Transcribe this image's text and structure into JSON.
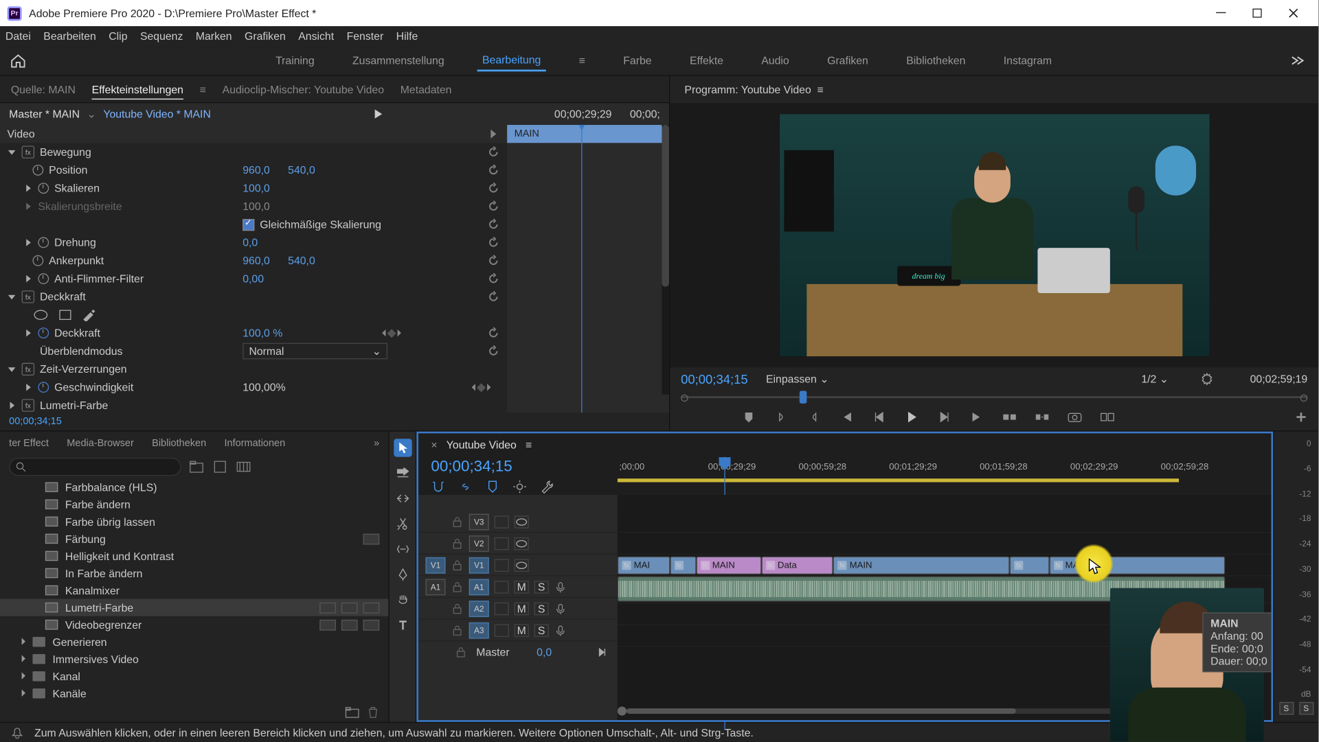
{
  "window": {
    "title": "Adobe Premiere Pro 2020 - D:\\Premiere Pro\\Master Effect *",
    "app_badge": "Pr"
  },
  "menu": [
    "Datei",
    "Bearbeiten",
    "Clip",
    "Sequenz",
    "Marken",
    "Grafiken",
    "Ansicht",
    "Fenster",
    "Hilfe"
  ],
  "workspaces": {
    "items": [
      "Training",
      "Zusammenstellung",
      "Bearbeitung",
      "Farbe",
      "Effekte",
      "Audio",
      "Grafiken",
      "Bibliotheken",
      "Instagram"
    ],
    "active": "Bearbeitung"
  },
  "source_tabs": {
    "items": [
      "Quelle: MAIN",
      "Effekteinstellungen",
      "Audioclip-Mischer: Youtube Video",
      "Metadaten"
    ],
    "active": "Effekteinstellungen"
  },
  "effects": {
    "master_label": "Master * MAIN",
    "clip_label": "Youtube Video * MAIN",
    "tc_head": "00;00;29;29",
    "tc_end": "00;00;",
    "clip_head": "MAIN",
    "video_section": "Video",
    "bewegung": {
      "name": "Bewegung",
      "position": {
        "label": "Position",
        "x": "960,0",
        "y": "540,0"
      },
      "skalieren": {
        "label": "Skalieren",
        "val": "100,0"
      },
      "skalierungsbreite": {
        "label": "Skalierungsbreite",
        "val": "100,0"
      },
      "gleichmaessig": "Gleichmäßige Skalierung",
      "drehung": {
        "label": "Drehung",
        "val": "0,0"
      },
      "ankerpunkt": {
        "label": "Ankerpunkt",
        "x": "960,0",
        "y": "540,0"
      },
      "antiflimmer": {
        "label": "Anti-Flimmer-Filter",
        "val": "0,00"
      }
    },
    "deckkraft": {
      "name": "Deckkraft",
      "value_label": "Deckkraft",
      "value": "100,0 %",
      "blend_label": "Überblendmodus",
      "blend_value": "Normal"
    },
    "zeit": {
      "name": "Zeit-Verzerrungen",
      "speed_label": "Geschwindigkeit",
      "speed_value": "100,00%"
    },
    "lumetri": {
      "name": "Lumetri-Farbe"
    },
    "panel_tc": "00;00;34;15"
  },
  "program": {
    "title": "Programm: Youtube Video",
    "tc_current": "00;00;34;15",
    "fit": "Einpassen",
    "ratio": "1/2",
    "duration": "00;02;59;19",
    "neon_sign": "dream big"
  },
  "project": {
    "tabs": [
      "ter Effect",
      "Media-Browser",
      "Bibliotheken",
      "Informationen"
    ],
    "items": [
      {
        "name": "Farbbalance (HLS)",
        "shortcuts": 0
      },
      {
        "name": "Farbe ändern",
        "shortcuts": 0
      },
      {
        "name": "Farbe übrig lassen",
        "shortcuts": 0
      },
      {
        "name": "Färbung",
        "shortcuts": 1
      },
      {
        "name": "Helligkeit und Kontrast",
        "shortcuts": 0
      },
      {
        "name": "In Farbe ändern",
        "shortcuts": 0
      },
      {
        "name": "Kanalmixer",
        "shortcuts": 0
      },
      {
        "name": "Lumetri-Farbe",
        "shortcuts": 3,
        "selected": true
      },
      {
        "name": "Videobegrenzer",
        "shortcuts": 3
      }
    ],
    "folders": [
      "Generieren",
      "Immersives Video",
      "Kanal",
      "Kanäle"
    ]
  },
  "timeline": {
    "name": "Youtube Video",
    "tc": "00;00;34;15",
    "ruler": [
      ";00;00",
      "00;00;29;29",
      "00;00;59;28",
      "00;01;29;29",
      "00;01;59;28",
      "00;02;29;29",
      "00;02;59;28"
    ],
    "playhead_pct": 19,
    "tracks_v": [
      "V3",
      "V2",
      "V1"
    ],
    "tracks_a": [
      "A1",
      "A2",
      "A3"
    ],
    "src_v": "V1",
    "src_a": "A1",
    "master_label": "Master",
    "master_val": "0,0",
    "clips": [
      {
        "label": "MAI",
        "start": 0,
        "width": 8,
        "color": "blue"
      },
      {
        "label": "",
        "start": 8,
        "width": 4,
        "color": "blue"
      },
      {
        "label": "MAIN",
        "start": 12,
        "width": 10,
        "color": "purple",
        "fx": true
      },
      {
        "label": "Data",
        "start": 22,
        "width": 11,
        "color": "purple",
        "fx": true
      },
      {
        "label": "MAIN",
        "start": 33,
        "width": 27,
        "color": "blue"
      },
      {
        "label": "",
        "start": 60,
        "width": 6,
        "color": "blue"
      },
      {
        "label": "MAIN",
        "start": 66,
        "width": 27,
        "color": "blue"
      }
    ],
    "tooltip": {
      "title": "MAIN",
      "l1": "Anfang: 00",
      "l2": "Ende: 00;0",
      "l3": "Dauer: 00;0"
    }
  },
  "meters": {
    "scale": [
      "0",
      "-6",
      "-12",
      "-18",
      "-24",
      "-30",
      "-36",
      "-42",
      "-48",
      "-54",
      "dB"
    ],
    "solo": "S"
  },
  "status": {
    "text": "Zum Auswählen klicken, oder in einen leeren Bereich klicken und ziehen, um Auswahl zu markieren. Weitere Optionen Umschalt-, Alt- und Strg-Taste."
  }
}
